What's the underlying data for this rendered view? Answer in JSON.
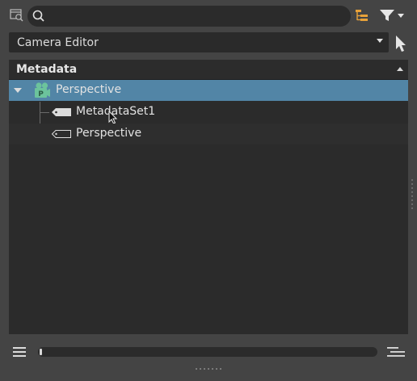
{
  "toolbar": {
    "search_placeholder": "",
    "search_value": "",
    "icons": [
      "search-scope-icon",
      "search-icon",
      "hierarchy-icon",
      "filter-icon"
    ],
    "accent_color": "#e8a23a"
  },
  "editor_select": {
    "selected": "Camera Editor"
  },
  "outliner": {
    "header_title": "Metadata",
    "rows": [
      {
        "label": "Perspective",
        "icon": "camera-icon",
        "icon_badge": "P",
        "expanded": true,
        "selected": true
      },
      {
        "label": "MetadataSet1",
        "icon": "tag-filled-icon",
        "selected": false
      },
      {
        "label": "Perspective",
        "icon": "tag-outline-icon",
        "selected": false
      }
    ],
    "selection_color": "#5285a6",
    "camera_icon_color": "#6cc39c"
  },
  "bottom": {
    "scroll_position": 0
  }
}
